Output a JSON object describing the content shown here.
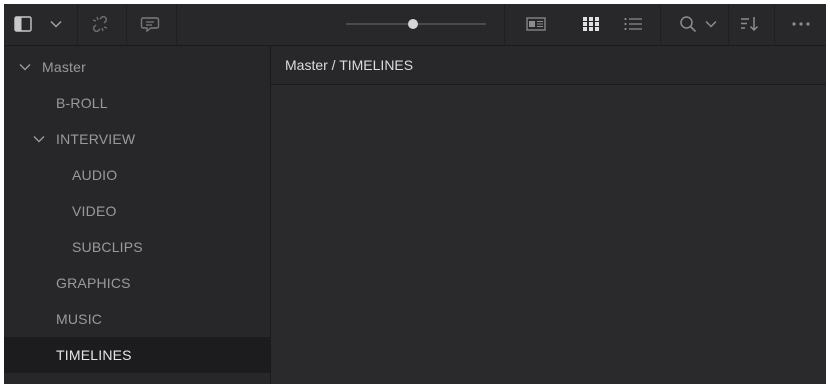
{
  "toolbar": {
    "icons": [
      "sidebar-toggle-icon",
      "chevron-down-icon",
      "unlink-icon",
      "comment-icon",
      "zoom-slider",
      "metadata-view-icon",
      "thumbnail-view-icon",
      "list-view-icon",
      "search-icon",
      "chevron-down-icon",
      "sort-icon",
      "more-options-icon"
    ],
    "zoom_level": 0.5
  },
  "breadcrumb": "Master / TIMELINES",
  "tree": [
    {
      "label": "Master",
      "expanded": true,
      "depth": 0
    },
    {
      "label": "B-ROLL",
      "depth": 1
    },
    {
      "label": "INTERVIEW",
      "expanded": true,
      "depth": 1
    },
    {
      "label": "AUDIO",
      "depth": 2
    },
    {
      "label": "VIDEO",
      "depth": 2
    },
    {
      "label": "SUBCLIPS",
      "depth": 2
    },
    {
      "label": "GRAPHICS",
      "depth": 1
    },
    {
      "label": "MUSIC",
      "depth": 1
    },
    {
      "label": "TIMELINES",
      "depth": 1,
      "selected": true
    }
  ],
  "colors": {
    "background": "#2a2a2d",
    "sidebar": "#27272a",
    "selected_row": "#1c1c1e",
    "text": "#9a9a9d",
    "text_selected": "#e6e6e8",
    "active_icon": "#e0e0e2"
  }
}
